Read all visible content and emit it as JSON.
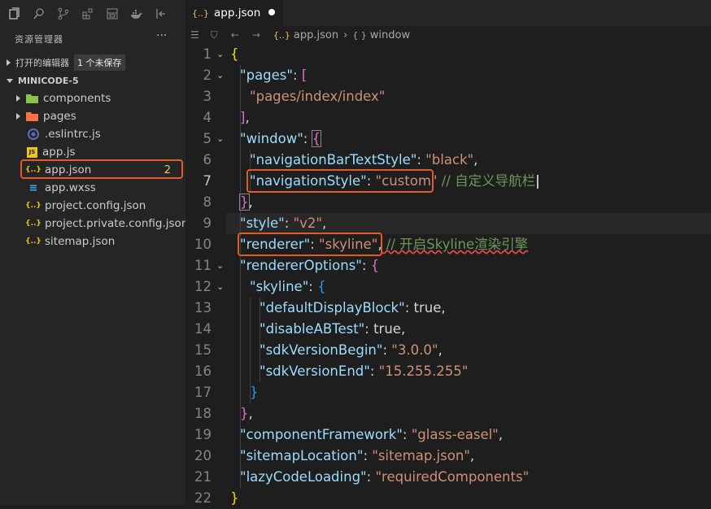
{
  "activity_icons": [
    "files-icon",
    "search-icon",
    "source-control-icon",
    "extensions-icon",
    "debug-icon",
    "docker-icon",
    "panel-icon"
  ],
  "explorer": {
    "title": "资源管理器",
    "more": "···",
    "open_editors": {
      "label": "打开的编辑器",
      "unsaved": "1 个未保存"
    },
    "project": {
      "label": "MINICODE-5"
    },
    "items": [
      {
        "label": "components",
        "icon": "folder-icon",
        "color": "#8bc34a",
        "expandable": true
      },
      {
        "label": "pages",
        "icon": "folder-icon",
        "color": "#ff7043",
        "expandable": true
      },
      {
        "label": ".eslintrc.js",
        "icon": "eslint-icon",
        "color": "#5c6bc0",
        "expandable": false
      },
      {
        "label": "app.js",
        "icon": "js-icon",
        "color": "#f0c419",
        "expandable": false
      },
      {
        "label": "app.json",
        "icon": "json-icon",
        "color": "#f0c419",
        "expandable": false,
        "badge": "2"
      },
      {
        "label": "app.wxss",
        "icon": "css-icon",
        "color": "#42a5f5",
        "expandable": false
      },
      {
        "label": "project.config.json",
        "icon": "json-icon",
        "color": "#f0c419",
        "expandable": false
      },
      {
        "label": "project.private.config.json",
        "icon": "json-icon",
        "color": "#f0c419",
        "expandable": false
      },
      {
        "label": "sitemap.json",
        "icon": "json-icon",
        "color": "#f0c419",
        "expandable": false
      }
    ]
  },
  "editor": {
    "tab": {
      "label": "app.json",
      "icon_glyph": "{..}"
    },
    "breadcrumb": {
      "file": "app.json",
      "symbol": "window",
      "file_glyph": "{..}",
      "symbol_glyph": "{ }"
    },
    "line_numbers": [
      "1",
      "2",
      "3",
      "4",
      "5",
      "6",
      "7",
      "8",
      "9",
      "10",
      "11",
      "12",
      "13",
      "14",
      "15",
      "16",
      "17",
      "18",
      "19",
      "20",
      "21",
      "22"
    ],
    "current_line": "7"
  },
  "code": {
    "l1_open": "{",
    "l2_key": "\"pages\"",
    "l2_colon": ": ",
    "l2_br": "[",
    "l3_val": "\"pages/index/index\"",
    "l4_br": "]",
    "l4_comma": ",",
    "l5_key": "\"window\"",
    "l5_colon": ": ",
    "l5_br": "{",
    "l6_key": "\"navigationBarTextStyle\"",
    "l6_colon": ": ",
    "l6_val": "\"black\"",
    "l6_comma": ",",
    "l7_key": "\"navigationStyle\"",
    "l7_colon": ": ",
    "l7_val": "\"custom\"",
    "l7_comment": " // 自定义导航栏",
    "l8_br": "}",
    "l8_comma": ",",
    "l9_key": "\"style\"",
    "l9_colon": ": ",
    "l9_val": "\"v2\"",
    "l9_comma": ",",
    "l10_key": "\"renderer\"",
    "l10_colon": ": ",
    "l10_val": "\"skyline\"",
    "l10_comma": ",",
    "l10_comment": " // 开启Skyline渲染引擎",
    "l11_key": "\"rendererOptions\"",
    "l11_colon": ": ",
    "l11_br": "{",
    "l12_key": "\"skyline\"",
    "l12_colon": ": ",
    "l12_br": "{",
    "l13_key": "\"defaultDisplayBlock\"",
    "l13_colon": ": ",
    "l13_val": "true",
    "l13_comma": ",",
    "l14_key": "\"disableABTest\"",
    "l14_colon": ": ",
    "l14_val": "true",
    "l14_comma": ",",
    "l15_key": "\"sdkVersionBegin\"",
    "l15_colon": ": ",
    "l15_val": "\"3.0.0\"",
    "l15_comma": ",",
    "l16_key": "\"sdkVersionEnd\"",
    "l16_colon": ": ",
    "l16_val": "\"15.255.255\"",
    "l17_br": "}",
    "l18_br": "}",
    "l18_comma": ",",
    "l19_key": "\"componentFramework\"",
    "l19_colon": ": ",
    "l19_val": "\"glass-easel\"",
    "l19_comma": ",",
    "l20_key": "\"sitemapLocation\"",
    "l20_colon": ": ",
    "l20_val": "\"sitemap.json\"",
    "l20_comma": ",",
    "l21_key": "\"lazyCodeLoading\"",
    "l21_colon": ": ",
    "l21_val": "\"requiredComponents\"",
    "l22_close": "}"
  },
  "colors": {
    "highlight_box": "#e05a2a",
    "key": "#9cdcfe",
    "string": "#ce9178",
    "comment": "#6a9955"
  }
}
